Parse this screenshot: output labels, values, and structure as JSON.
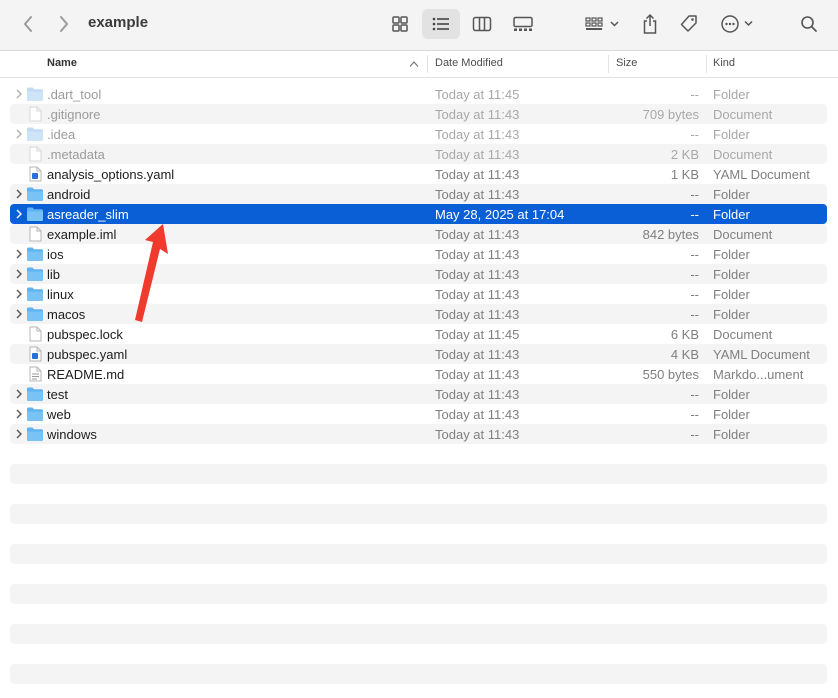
{
  "window": {
    "title": "example"
  },
  "toolbar": {
    "back": "chevron-left-icon",
    "forward": "chevron-right-icon",
    "views": [
      "icon-view",
      "list-view",
      "column-view",
      "gallery-view"
    ],
    "active_view": "list-view",
    "group": "group-by-icon",
    "share": "share-icon",
    "tag": "tag-icon",
    "more": "ellipsis-icon",
    "search": "search-icon"
  },
  "columns": {
    "name": "Name",
    "date": "Date Modified",
    "size": "Size",
    "kind": "Kind"
  },
  "files": [
    {
      "name": ".dart_tool",
      "date": "Today at 11:45",
      "size": "--",
      "kind": "Folder",
      "type": "folder",
      "dim": true,
      "expandable": true
    },
    {
      "name": ".gitignore",
      "date": "Today at 11:43",
      "size": "709 bytes",
      "kind": "Document",
      "type": "doc",
      "dim": true,
      "expandable": false
    },
    {
      "name": ".idea",
      "date": "Today at 11:43",
      "size": "--",
      "kind": "Folder",
      "type": "folder",
      "dim": true,
      "expandable": true
    },
    {
      "name": ".metadata",
      "date": "Today at 11:43",
      "size": "2 KB",
      "kind": "Document",
      "type": "doc",
      "dim": true,
      "expandable": false
    },
    {
      "name": "analysis_options.yaml",
      "date": "Today at 11:43",
      "size": "1 KB",
      "kind": "YAML Document",
      "type": "yaml",
      "dim": false,
      "expandable": false
    },
    {
      "name": "android",
      "date": "Today at 11:43",
      "size": "--",
      "kind": "Folder",
      "type": "folder",
      "dim": false,
      "expandable": true
    },
    {
      "name": "asreader_slim",
      "date": "May 28, 2025 at 17:04",
      "size": "--",
      "kind": "Folder",
      "type": "folder",
      "dim": false,
      "expandable": true,
      "selected": true
    },
    {
      "name": "example.iml",
      "date": "Today at 11:43",
      "size": "842 bytes",
      "kind": "Document",
      "type": "doc",
      "dim": false,
      "expandable": false
    },
    {
      "name": "ios",
      "date": "Today at 11:43",
      "size": "--",
      "kind": "Folder",
      "type": "folder",
      "dim": false,
      "expandable": true
    },
    {
      "name": "lib",
      "date": "Today at 11:43",
      "size": "--",
      "kind": "Folder",
      "type": "folder",
      "dim": false,
      "expandable": true
    },
    {
      "name": "linux",
      "date": "Today at 11:43",
      "size": "--",
      "kind": "Folder",
      "type": "folder",
      "dim": false,
      "expandable": true
    },
    {
      "name": "macos",
      "date": "Today at 11:43",
      "size": "--",
      "kind": "Folder",
      "type": "folder",
      "dim": false,
      "expandable": true
    },
    {
      "name": "pubspec.lock",
      "date": "Today at 11:45",
      "size": "6 KB",
      "kind": "Document",
      "type": "doc",
      "dim": false,
      "expandable": false
    },
    {
      "name": "pubspec.yaml",
      "date": "Today at 11:43",
      "size": "4 KB",
      "kind": "YAML Document",
      "type": "yaml",
      "dim": false,
      "expandable": false
    },
    {
      "name": "README.md",
      "date": "Today at 11:43",
      "size": "550 bytes",
      "kind": "Markdo...ument",
      "type": "md",
      "dim": false,
      "expandable": false
    },
    {
      "name": "test",
      "date": "Today at 11:43",
      "size": "--",
      "kind": "Folder",
      "type": "folder",
      "dim": false,
      "expandable": true
    },
    {
      "name": "web",
      "date": "Today at 11:43",
      "size": "--",
      "kind": "Folder",
      "type": "folder",
      "dim": false,
      "expandable": true
    },
    {
      "name": "windows",
      "date": "Today at 11:43",
      "size": "--",
      "kind": "Folder",
      "type": "folder",
      "dim": false,
      "expandable": true
    }
  ],
  "colors": {
    "selection": "#0a5fd6",
    "folder": "#5eb3f0",
    "annotation_arrow": "#f03a2e"
  }
}
